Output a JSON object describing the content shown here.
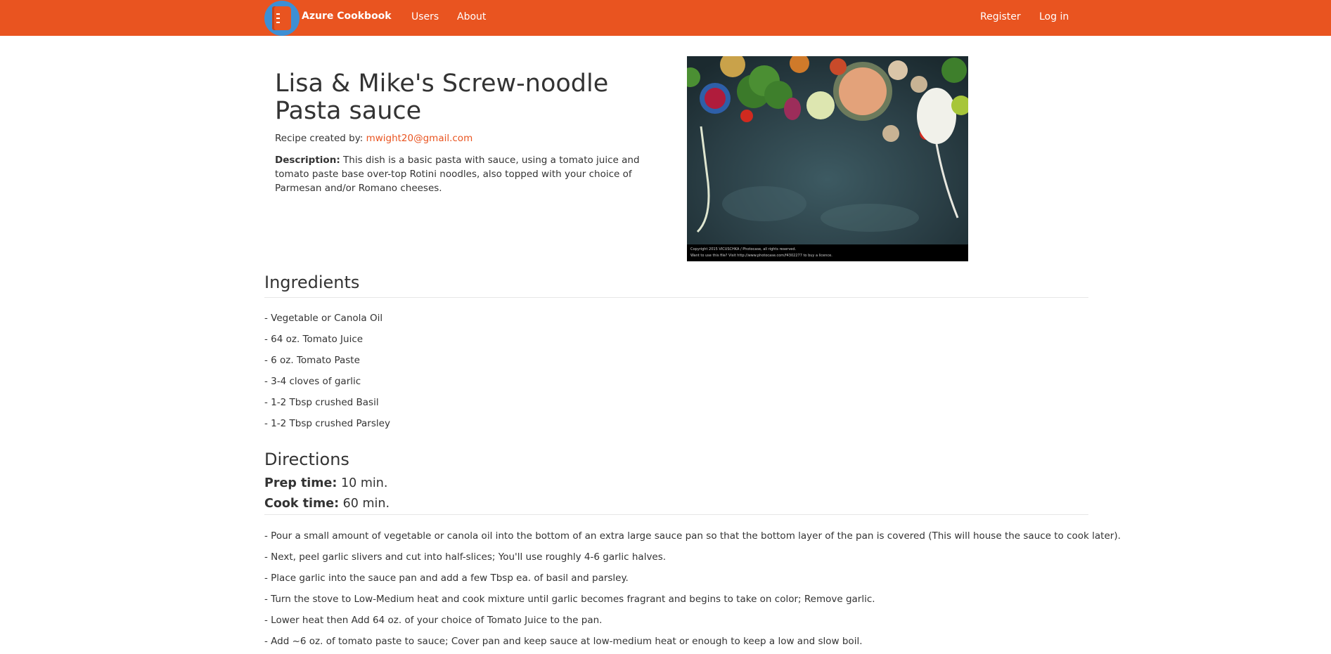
{
  "nav": {
    "brand": "Azure Cookbook",
    "links": [
      "Users",
      "About"
    ],
    "right_links": [
      "Register",
      "Log in"
    ]
  },
  "recipe": {
    "title": "Lisa & Mike's Screw-noodle Pasta sauce",
    "created_label": "Recipe created by:",
    "creator_email": "mwight20@gmail.com",
    "description_label": "Description:",
    "description": "This dish is a basic pasta with sauce, using a tomato juice and tomato paste base over-top Rotini noodles, also topped with your choice of Parmesan and/or Romano cheeses.",
    "image_caption_line1": "Copyright 2015 VICUSCHKA / Photocase, all rights reserved.",
    "image_caption_line2": "Want to use this file? Visit http://www.photocase.com/f4302277 to buy a licence."
  },
  "ingredients": {
    "heading": "Ingredients",
    "items": [
      "- Vegetable or Canola Oil",
      "- 64 oz. Tomato Juice",
      "- 6 oz. Tomato Paste",
      "- 3-4 cloves of garlic",
      "- 1-2 Tbsp crushed Basil",
      "- 1-2 Tbsp crushed Parsley"
    ]
  },
  "directions": {
    "heading": "Directions",
    "prep_label": "Prep time:",
    "prep_value": "10 min.",
    "cook_label": "Cook time:",
    "cook_value": "60 min.",
    "steps": [
      "- Pour a small amount of vegetable or canola oil into the bottom of an extra large sauce pan so that the bottom layer of the pan is covered (This will house the sauce to cook later).",
      "- Next, peel garlic slivers and cut into half-slices; You'll use roughly 4-6 garlic halves.",
      "- Place garlic into the sauce pan and add a few Tbsp ea. of basil and parsley.",
      "- Turn the stove to Low-Medium heat and cook mixture until garlic becomes fragrant and begins to take on color; Remove garlic.",
      "- Lower heat then Add 64 oz. of your choice of Tomato Juice to the pan.",
      "- Add ~6 oz. of tomato paste to sauce; Cover pan and keep sauce at low-medium heat or enough to keep a low and slow boil."
    ]
  },
  "colors": {
    "navbar": "#e95420",
    "link": "#e95420",
    "logo_circle": "#3d8fd4"
  }
}
